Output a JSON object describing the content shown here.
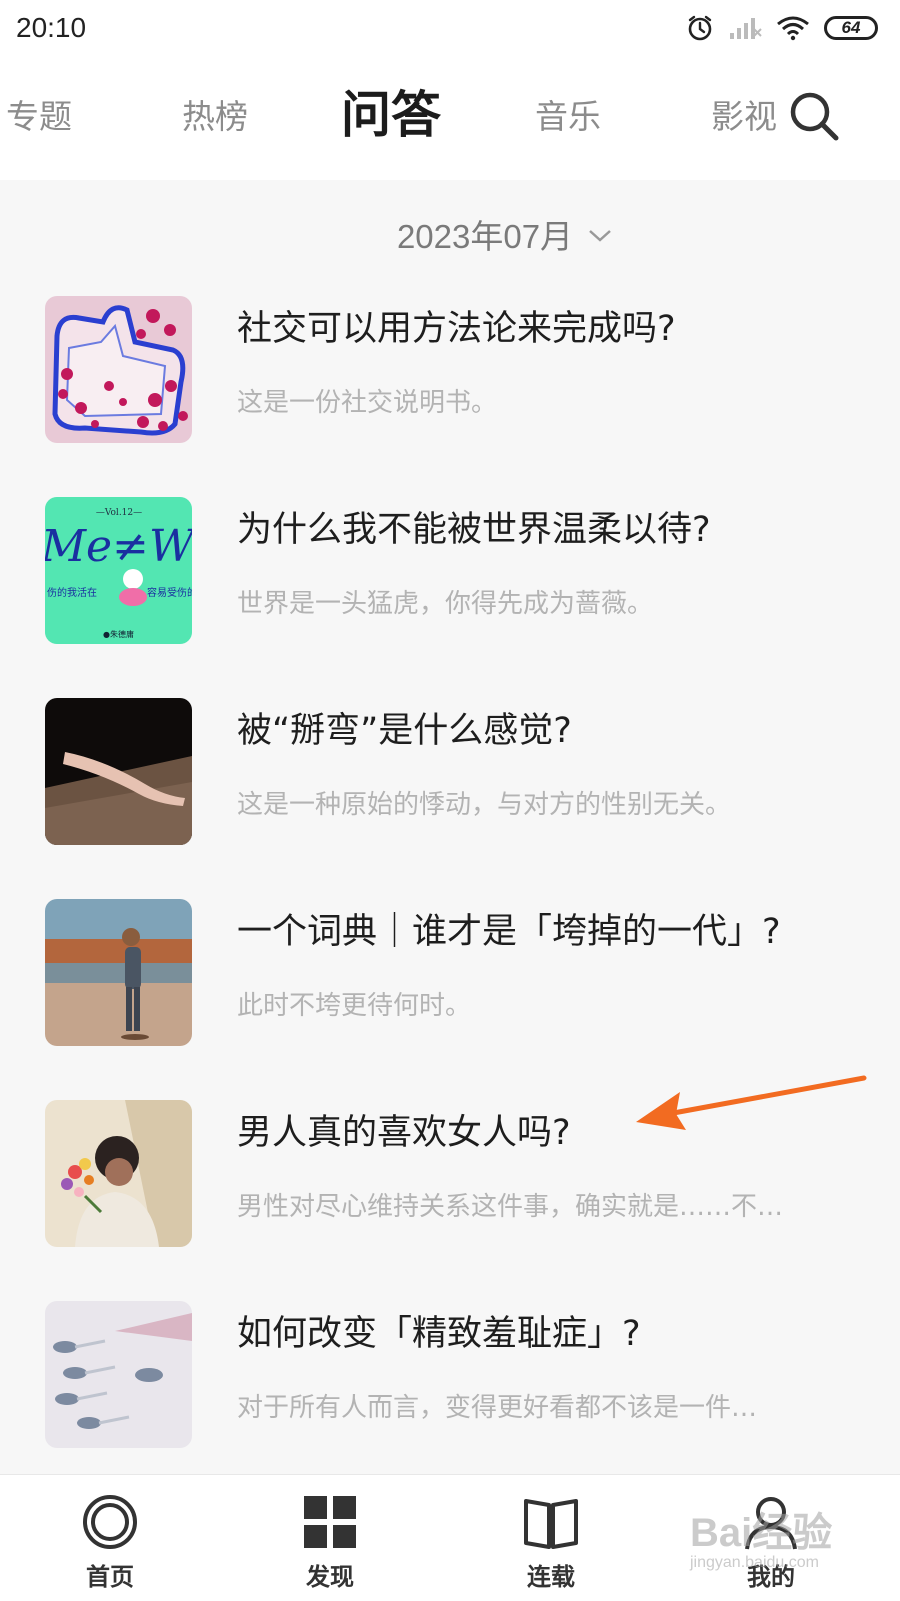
{
  "status_bar": {
    "time": "20:10",
    "battery": "64",
    "icons": [
      "alarm-icon",
      "signal-icon",
      "wifi-icon",
      "battery-icon"
    ]
  },
  "top_tabs": [
    {
      "label": "专题",
      "active": false
    },
    {
      "label": "热榜",
      "active": false
    },
    {
      "label": "问答",
      "active": true
    },
    {
      "label": "音乐",
      "active": false
    },
    {
      "label": "影视",
      "active": false
    }
  ],
  "search_icon": "search-icon",
  "month_picker": {
    "label": "2023年07月",
    "icon": "chevron-down-icon"
  },
  "articles": [
    {
      "title": "社交可以用方法论来完成吗?",
      "subtitle": "这是一份社交说明书。"
    },
    {
      "title": "为什么我不能被世界温柔以待?",
      "subtitle": "世界是一头猛虎，你得先成为蔷薇。"
    },
    {
      "title": "被“掰弯”是什么感觉?",
      "subtitle": "这是一种原始的悸动，与对方的性别无关。"
    },
    {
      "title": "一个词典｜谁才是「垮掉的一代」?",
      "subtitle": "此时不垮更待何时。"
    },
    {
      "title": "男人真的喜欢女人吗?",
      "subtitle": "男性对尽心维持关系这件事，确实就是……不…"
    },
    {
      "title": "如何改变「精致羞耻症」?",
      "subtitle": "对于所有人而言，变得更好看都不该是一件…"
    }
  ],
  "thumbnail_2_text": {
    "vol": "—Vol.12—",
    "big": "Me≠W",
    "left": "伤的我活在",
    "right": "容易受伤的",
    "author": "●朱德庸"
  },
  "bottom_nav": [
    {
      "label": "首页",
      "icon": "home-circle-icon"
    },
    {
      "label": "发现",
      "icon": "discover-grid-icon"
    },
    {
      "label": "连载",
      "icon": "book-icon"
    },
    {
      "label": "我的",
      "icon": "profile-icon"
    }
  ],
  "watermark": {
    "text": "Bai经验",
    "url": "jingyan.baidu.com"
  },
  "colors": {
    "accent_arrow": "#f26b21",
    "background": "#f7f7f7",
    "title_text": "#1e1e1e",
    "subtitle_text": "#b3b3b3"
  }
}
